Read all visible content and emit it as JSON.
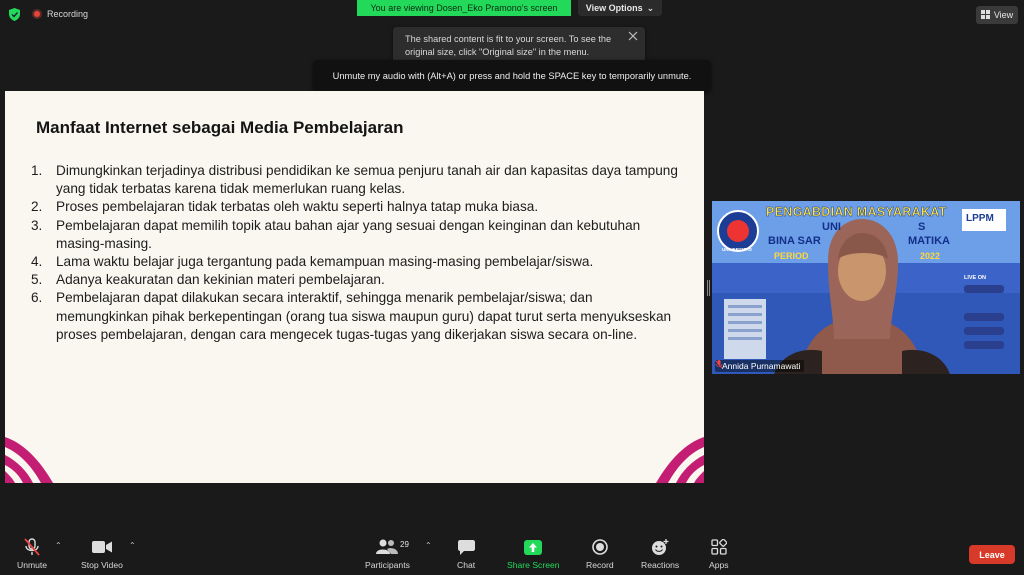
{
  "status": {
    "recording_label": "Recording"
  },
  "banner": {
    "viewing_text": "You are viewing Dosen_Eko Pramono's screen",
    "view_options_label": "View Options"
  },
  "tooltips": {
    "fit_line1": "The shared content is fit to your screen. To see the",
    "fit_line2": "original size, click \"Original size\" in the menu.",
    "unmute_text": "Unmute my audio with (Alt+A) or press and hold the SPACE key to temporarily unmute."
  },
  "view_button": {
    "label": "View"
  },
  "slide": {
    "title": "Manfaat Internet sebagai Media Pembelajaran",
    "items": [
      {
        "num": "1.",
        "text": "Dimungkinkan terjadinya distribusi pendidikan ke semua penjuru tanah air dan kapasitas daya tampung yang tidak terbatas karena tidak memerlukan ruang kelas."
      },
      {
        "num": "2.",
        "text": "Proses pembelajaran tidak terbatas oleh waktu seperti halnya tatap muka biasa."
      },
      {
        "num": "3.",
        "text": "Pembelajaran dapat memilih topik atau bahan ajar yang sesuai dengan keinginan dan kebutuhan masing-masing."
      },
      {
        "num": "4.",
        "text": "Lama waktu belajar juga tergantung pada kemampuan masing-masing pembelajar/siswa."
      },
      {
        "num": "5.",
        "text": "Adanya keakuratan dan kekinian materi pembelajaran."
      },
      {
        "num": "6.",
        "text": "Pembelajaran dapat dilakukan secara interaktif, sehingga menarik pembelajar/siswa; dan memungkinkan pihak berkepentingan (orang tua siswa maupun guru) dapat turut serta menyukseskan proses pembelajaran, dengan cara mengecek tugas-tugas yang dikerjakan siswa secara on-line."
      }
    ]
  },
  "video": {
    "participant_name": "Annida Purnamawati",
    "banner_line1": "PENGABDIAN MASYARAKAT",
    "banner_line2": "UNI",
    "banner_line2b": "S",
    "banner_line3": "BINA SAR",
    "banner_line3b": "MATIKA",
    "banner_line4": "PERIOD",
    "banner_line4b": "2022",
    "lppm_label": "LPPM",
    "live_label": "LIVE ON",
    "logo_label": "UNIVERSITAS"
  },
  "toolbar": {
    "mute_label": "Unmute",
    "video_label": "Stop Video",
    "participants_label": "Participants",
    "participants_count": "29",
    "chat_label": "Chat",
    "share_label": "Share Screen",
    "record_label": "Record",
    "reactions_label": "Reactions",
    "apps_label": "Apps",
    "leave_label": "Leave"
  },
  "colors": {
    "share_green": "#23d959",
    "leave_red": "#d83a2a",
    "slide_bg": "#f9f7ef",
    "deco_magenta": "#c41e74"
  }
}
